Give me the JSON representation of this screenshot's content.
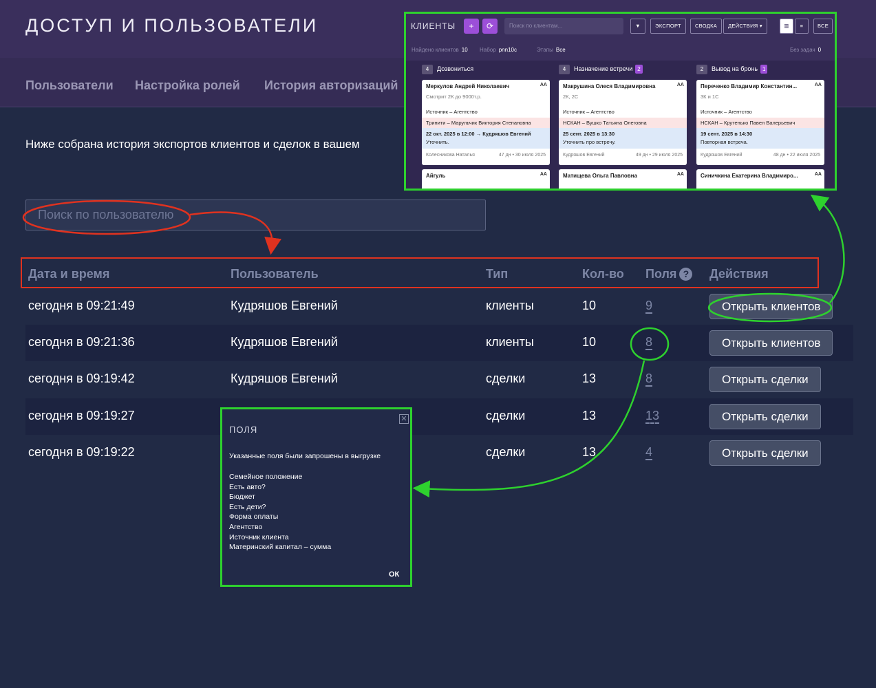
{
  "page": {
    "title": "ДОСТУП И ПОЛЬЗОВАТЕЛИ",
    "tabs": [
      "Пользователи",
      "Настройка ролей",
      "История авторизаций"
    ],
    "intro": "Ниже собрана история экспортов клиентов и сделок в вашем"
  },
  "search": {
    "placeholder": "Поиск по пользователю"
  },
  "table": {
    "headers": [
      "Дата и время",
      "Пользователь",
      "Тип",
      "Кол-во",
      "Поля",
      "Действия"
    ],
    "help_icon": "?",
    "rows": [
      {
        "datetime": "сегодня в 09:21:49",
        "user": "Кудряшов Евгений",
        "type": "клиенты",
        "count": "10",
        "fields": "9",
        "action": "Открыть клиентов"
      },
      {
        "datetime": "сегодня в 09:21:36",
        "user": "Кудряшов Евгений",
        "type": "клиенты",
        "count": "10",
        "fields": "8",
        "action": "Открыть клиентов"
      },
      {
        "datetime": "сегодня в 09:19:42",
        "user": "Кудряшов Евгений",
        "type": "сделки",
        "count": "13",
        "fields": "8",
        "action": "Открыть сделки"
      },
      {
        "datetime": "сегодня в 09:19:27",
        "user": "",
        "type": "сделки",
        "count": "13",
        "fields": "13",
        "action": "Открыть сделки"
      },
      {
        "datetime": "сегодня в 09:19:22",
        "user": "",
        "type": "сделки",
        "count": "13",
        "fields": "4",
        "action": "Открыть сделки"
      }
    ]
  },
  "popup": {
    "title": "ПОЛЯ",
    "description": "Указанные поля были запрошены в выгрузке",
    "fields": [
      "Семейное положение",
      "Есть авто?",
      "Бюджет",
      "Есть дети?",
      "Форма оплаты",
      "Агентство",
      "Источник клиента",
      "Материнский капитал – сумма"
    ],
    "ok": "ОК"
  },
  "kanban": {
    "title": "КЛИЕНТЫ",
    "search_placeholder": "Поиск по клиентам...",
    "buttons": {
      "export": "ЭКСПОРТ",
      "summary": "СВОДКА",
      "actions": "ДЕЙСТВИЯ",
      "all": "ВСЕ"
    },
    "meta": {
      "found_label": "Найдено клиентов",
      "found_value": "10",
      "set_label": "Набор",
      "set_value": "pnn10c",
      "stages_label": "Этапы",
      "stages_value": "Все",
      "no_tasks_label": "Без задач",
      "no_tasks_value": "0"
    },
    "columns": [
      {
        "count": "4",
        "name": "Дозвониться",
        "badge": "",
        "cards": [
          {
            "name": "Меркулов Андрей Николаевич",
            "tag": "AA",
            "sub": "Смотрит 2К до 9000т.р.",
            "source": "Источник – Агентство",
            "pink": "Тринити – Марульчик Виктория Степановна",
            "blue1": "22 окт. 2025 в 12:00 → Кудряшов Евгений",
            "blue2": "Уточнить.",
            "footer_left": "Колесникова Наталья",
            "footer_right": "47 дн • 30 июля 2025"
          },
          {
            "name": "Айгуль",
            "tag": "AA"
          }
        ]
      },
      {
        "count": "4",
        "name": "Назначение встречи",
        "badge": "2",
        "cards": [
          {
            "name": "Макрушина Олеся Владимировна",
            "tag": "AA",
            "sub": "2К, 2С",
            "source": "Источник – Агентство",
            "pink": "НСКАН – Вушко Татьяна Олеговна",
            "blue1": "25 сент. 2025 в 13:30",
            "blue2": "Уточнить про встречу.",
            "footer_left": "Кудряшов Евгений",
            "footer_right": "49 дн • 29 июля 2025"
          },
          {
            "name": "Матищева Ольга Павловна",
            "tag": "AA"
          }
        ]
      },
      {
        "count": "2",
        "name": "Вывод на бронь",
        "badge": "1",
        "cards": [
          {
            "name": "Переченко Владимир Константин...",
            "tag": "AA",
            "sub": "3К и 1С",
            "source": "Источник – Агентство",
            "pink": "НСКАН – Крутенько Павел Валерьевич",
            "blue1": "19 сент. 2025 в 14:30",
            "blue2": "Повторная встреча.",
            "footer_left": "Кудряшов Евгений",
            "footer_right": "48 дн • 22 июля 2025"
          },
          {
            "name": "Синичкина Екатерина Владимиро...",
            "tag": "AA"
          }
        ]
      }
    ]
  },
  "colors": {
    "annotation_red": "#e0321f",
    "annotation_green": "#2ed12e",
    "accent_purple": "#9c4fd8"
  }
}
